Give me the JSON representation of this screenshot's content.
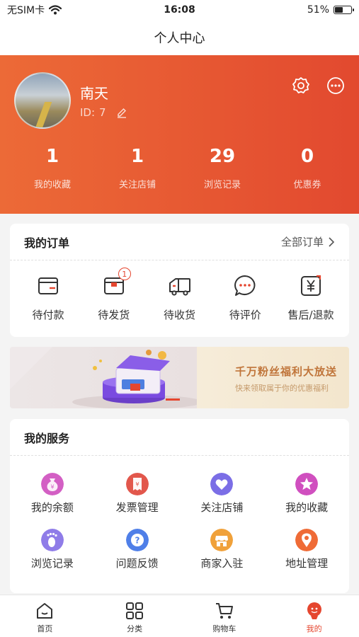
{
  "status_bar": {
    "carrier": "无SIM卡",
    "time": "16:08",
    "battery": "51%",
    "battery_level": 0.51
  },
  "nav": {
    "title": "个人中心"
  },
  "profile": {
    "name": "南天",
    "id_label": "ID:",
    "id_value": "7"
  },
  "stats": [
    {
      "value": "1",
      "label": "我的收藏"
    },
    {
      "value": "1",
      "label": "关注店铺"
    },
    {
      "value": "29",
      "label": "浏览记录"
    },
    {
      "value": "0",
      "label": "优惠券"
    }
  ],
  "orders": {
    "title": "我的订单",
    "all_label": "全部订单",
    "items": [
      {
        "label": "待付款",
        "icon": "wallet-icon"
      },
      {
        "label": "待发货",
        "icon": "package-icon",
        "badge": "1"
      },
      {
        "label": "待收货",
        "icon": "truck-icon"
      },
      {
        "label": "待评价",
        "icon": "chat-icon"
      },
      {
        "label": "售后/退款",
        "icon": "yen-refund-icon"
      }
    ]
  },
  "banner": {
    "title": "千万粉丝福利大放送",
    "subtitle": "快来领取属于你的优惠福利"
  },
  "services": {
    "title": "我的服务",
    "items": [
      {
        "label": "我的余额",
        "icon": "money-bag-icon",
        "color": "#d35fc4"
      },
      {
        "label": "发票管理",
        "icon": "invoice-icon",
        "color": "#e2574c"
      },
      {
        "label": "关注店铺",
        "icon": "heart-icon",
        "color": "#7b6ee6"
      },
      {
        "label": "我的收藏",
        "icon": "star-icon",
        "color": "#d04fbf"
      },
      {
        "label": "浏览记录",
        "icon": "footprint-icon",
        "color": "#8f7ce8"
      },
      {
        "label": "问题反馈",
        "icon": "question-icon",
        "color": "#4f7fe8"
      },
      {
        "label": "商家入驻",
        "icon": "store-icon",
        "color": "#f0a13a"
      },
      {
        "label": "地址管理",
        "icon": "location-icon",
        "color": "#ef6b36"
      }
    ]
  },
  "tabs": [
    {
      "label": "首页",
      "icon": "home-icon"
    },
    {
      "label": "分类",
      "icon": "category-icon"
    },
    {
      "label": "购物车",
      "icon": "cart-icon"
    },
    {
      "label": "我的",
      "icon": "profile-icon",
      "active": true
    }
  ],
  "colors": {
    "accent": "#e5462f",
    "header_start": "#ec6a37",
    "header_end": "#e2492f"
  }
}
